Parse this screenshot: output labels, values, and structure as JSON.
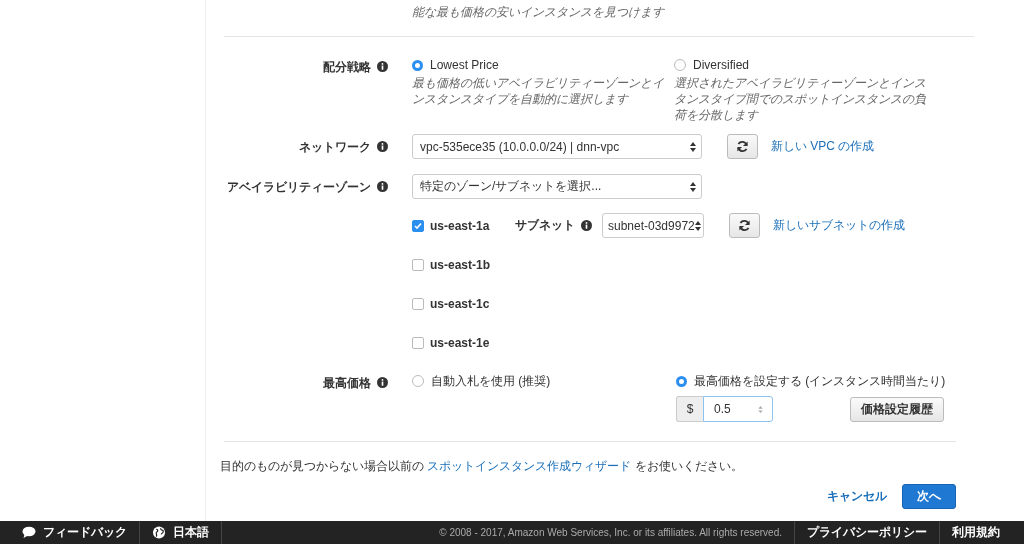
{
  "intro_text": "能な最も価格の安いインスタンスを見つけます",
  "allocation_strategy": {
    "label": "配分戦略",
    "options": [
      {
        "label": "Lowest Price",
        "description": "最も価格の低いアベイラビリティーゾーンとインスタンスタイプを自動的に選択します",
        "selected": true
      },
      {
        "label": "Diversified",
        "description": "選択されたアベイラビリティーゾーンとインスタンスタイプ間でのスポットインスタンスの負荷を分散します",
        "selected": false
      }
    ]
  },
  "network": {
    "label": "ネットワーク",
    "value": "vpc-535ece35 (10.0.0.0/24) | dnn-vpc",
    "new_link": "新しい VPC の作成"
  },
  "availability_zone": {
    "label": "アベイラビリティーゾーン",
    "value": "特定のゾーン/サブネットを選択..."
  },
  "zones": [
    {
      "name": "us-east-1a",
      "checked": true,
      "subnet": {
        "label": "サブネット",
        "value": "subnet-03d9972",
        "new_link": "新しいサブネットの作成"
      }
    },
    {
      "name": "us-east-1b",
      "checked": false
    },
    {
      "name": "us-east-1c",
      "checked": false
    },
    {
      "name": "us-east-1e",
      "checked": false
    }
  ],
  "max_price": {
    "label": "最高価格",
    "options": [
      {
        "label": "自動入札を使用 (推奨)",
        "selected": false
      },
      {
        "label": "最高価格を設定する (インスタンス時間当たり)",
        "selected": true
      }
    ],
    "currency": "$",
    "value": "0.5",
    "history_button": "価格設定履歴"
  },
  "footer_note": {
    "before": "目的のものが見つからない場合以前の",
    "link": "スポットインスタンス作成ウィザード",
    "after": "をお使いください。"
  },
  "buttons": {
    "cancel": "キャンセル",
    "next": "次へ"
  },
  "status_bar": {
    "feedback": "フィードバック",
    "language": "日本語",
    "copyright": "© 2008 - 2017, Amazon Web Services, Inc. or its affiliates. All rights reserved.",
    "privacy": "プライバシーポリシー",
    "terms": "利用規約"
  }
}
